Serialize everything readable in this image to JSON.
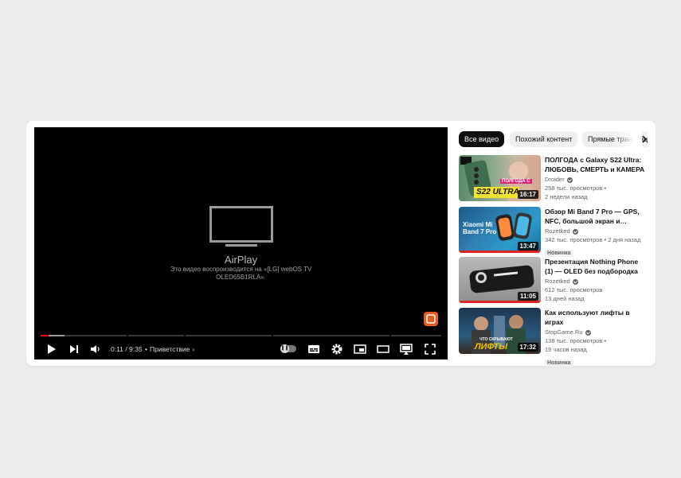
{
  "player": {
    "airplay_title": "AirPlay",
    "airplay_text": "Это видео воспроизводится на «[LG] webOS TV OLED65B1RLA».",
    "time": "0:11 / 9:35",
    "chapter": "Приветствие",
    "progress_fraction": 0.019,
    "icons": [
      "play-icon",
      "next-icon",
      "volume-icon",
      "autoplay-toggle",
      "subtitles-icon",
      "settings-icon",
      "miniplayer-icon",
      "theater-icon",
      "airplay-icon",
      "fullscreen-icon"
    ]
  },
  "chips": [
    "Все видео",
    "Похожий контент",
    "Прямые трансляции"
  ],
  "videos": [
    {
      "title": "ПОЛГОДА с Galaxy S22 Ultra: ЛЮБОВЬ, СМЕРТЬ и КАМЕРА",
      "channel": "Droider",
      "views": "258 тыс. просмотров",
      "age": "2 недели назад",
      "duration": "16:17",
      "thumb_text": "S22 ULTRA",
      "thumb_text2": "ПОЛГОДА С",
      "badge": ""
    },
    {
      "title": "Обзор Mi Band 7 Pro — GPS, NFC, большой экран и…",
      "channel": "Rozetked",
      "views": "342 тыс. просмотров",
      "age": "2 дня назад",
      "duration": "13:47",
      "thumb_text": "Xiaomi Mi Band 7 Pro",
      "badge": "Новинка"
    },
    {
      "title": "Презентация Nothing Phone (1) — OLED без подбородка и…",
      "channel": "Rozetked",
      "views": "612 тыс. просмотров",
      "age": "13 дней назад",
      "duration": "11:05",
      "badge": ""
    },
    {
      "title": "Как используют лифты в играх",
      "channel": "StopGame.Ru",
      "views": "138 тыс. просмотров",
      "age": "19 часов назад",
      "duration": "17:32",
      "thumb_text": "ЛИФТЫ",
      "thumb_text2": "ЧТО СКРЫВАЮТ",
      "badge": "Новинка"
    }
  ]
}
